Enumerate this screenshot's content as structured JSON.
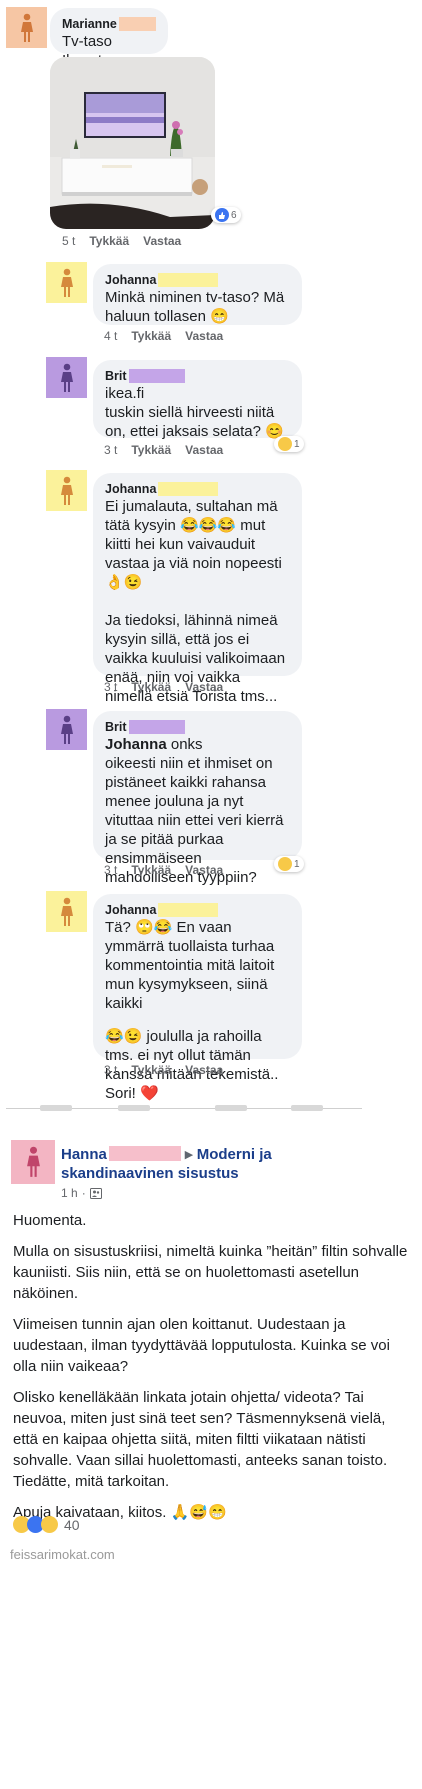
{
  "colors": {
    "avatar_orange": "#f6c6a4",
    "avatar_yellow": "#fbf29b",
    "avatar_purple": "#b99ae0",
    "avatar_pink": "#f3b5c3",
    "mask_orange": "#f9cfb2",
    "mask_yellow": "#fbf29b",
    "mask_purple": "#c4a5e8",
    "mask_pink": "#f6bfcb",
    "link_blue": "#1b3e8a"
  },
  "comments": [
    {
      "author": "Marianne",
      "text": "Tv-taso Ikeasta",
      "time": "5 t",
      "like": "Tykkää",
      "reply": "Vastaa",
      "reaction_count": "6"
    },
    {
      "author": "Johanna",
      "text": "Minkä niminen tv-taso? Mä haluun tollasen 😁",
      "time": "4 t",
      "like": "Tykkää",
      "reply": "Vastaa"
    },
    {
      "author": "Brit",
      "line1": "ikea.fi",
      "line2": "tuskin siellä hirveesti niitä on, ettei jaksais selata? 😊",
      "time": "3 t",
      "like": "Tykkää",
      "reply": "Vastaa",
      "reaction_count": "1"
    },
    {
      "author": "Johanna",
      "p1": "Ei jumalauta, sultahan mä tätä kysyin 😂😂😂 mut kiitti hei kun vaivauduit vastaa ja viä noin nopeesti👌😉",
      "p2": "Ja tiedoksi, lähinnä nimeä kysyin sillä, että jos ei vaikka kuuluisi valikoimaan enää, niin voi vaikka nimellä etsiä Torista tms...",
      "time": "3 t",
      "like": "Tykkää",
      "reply": "Vastaa"
    },
    {
      "author": "Brit",
      "mention": "Johanna",
      "mention_tail": " onks",
      "text": "oikeesti niin et ihmiset on pistäneet kaikki rahansa menee jouluna ja nyt vituttaa niin ettei veri kierrä ja se pitää purkaa ensimmäiseen mahdolliseen tyyppiin?",
      "time": "3 t",
      "like": "Tykkää",
      "reply": "Vastaa",
      "reaction_count": "1"
    },
    {
      "author": "Johanna",
      "p1": "Tä? 🙄😂 En vaan ymmärrä tuollaista turhaa kommentointia mitä laitoit mun kysymykseen, siinä kaikki",
      "p2": "😂😉 joululla ja rahoilla tms. ei nyt ollut tämän kanssa mitään tekemistä.. Sori! ❤️",
      "time": "3 t",
      "like": "Tykkää",
      "reply": "Vastaa"
    }
  ],
  "post": {
    "author": "Hanna",
    "arrow": "▸",
    "group": "Moderni ja skandinaavinen sisustus",
    "time": "1 h",
    "dot": "·",
    "paragraphs": [
      "Huomenta.",
      "Mulla on sisustuskriisi, nimeltä kuinka ”heitän” filtin sohvalle kauniisti. Siis niin, että se on huolettomasti asetellun näköinen.",
      "Viimeisen tunnin ajan olen koittanut. Uudestaan ja uudestaan, ilman tyydyttävää lopputulosta. Kuinka se voi olla niin vaikeaa?",
      "Olisko kenelläkään linkata jotain ohjetta/ videota? Tai neuvoa, miten just sinä teet sen? Täsmennyksenä vielä, että en kaipaa ohjetta siitä, miten filtti viikataan nätisti sohvalle. Vaan sillai huolettomasti, anteeks sanan toisto. Tiedätte, mitä tarkoitan.",
      "Apuja kaivataan, kiitos. 🙏😅😁"
    ],
    "reaction_count": "40"
  },
  "watermark": "feissarimokat.com"
}
